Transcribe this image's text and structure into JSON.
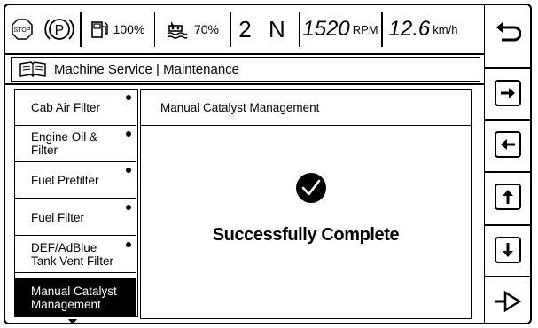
{
  "status_bar": {
    "stop_icon_label": "STOP",
    "park_icon_label": "P",
    "fuel_level": "100%",
    "def_level": "70%",
    "gear": "2 N",
    "engine_speed": "1520",
    "engine_speed_unit": "RPM",
    "ground_speed": "12.6",
    "ground_speed_unit": "km/h"
  },
  "header": {
    "title": "Machine Service | Maintenance",
    "icon": "manual-book-icon"
  },
  "menu": {
    "items": [
      {
        "label": "Cab Air Filter",
        "has_indicator": true,
        "selected": false
      },
      {
        "label": "Engine Oil &\nFilter",
        "has_indicator": true,
        "selected": false
      },
      {
        "label": "Fuel Prefilter",
        "has_indicator": true,
        "selected": false
      },
      {
        "label": "Fuel Filter",
        "has_indicator": true,
        "selected": false
      },
      {
        "label": "DEF/AdBlue\nTank Vent Filter",
        "has_indicator": true,
        "selected": false
      },
      {
        "label": "Manual Catalyst\nManagement",
        "has_indicator": false,
        "selected": true
      }
    ]
  },
  "panel": {
    "title": "Manual Catalyst Management",
    "status_message": "Successfully Complete",
    "status_icon": "checkmark-circle-icon"
  },
  "nav_buttons": [
    {
      "icon": "back-icon"
    },
    {
      "icon": "right-arrow-icon"
    },
    {
      "icon": "left-arrow-icon"
    },
    {
      "icon": "up-arrow-icon"
    },
    {
      "icon": "down-arrow-icon"
    },
    {
      "icon": "enter-icon"
    }
  ]
}
